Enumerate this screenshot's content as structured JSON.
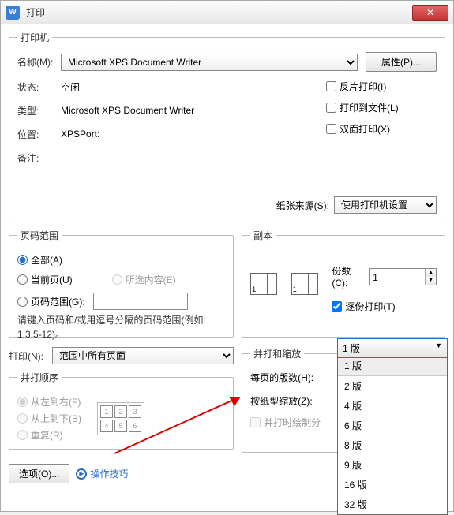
{
  "window": {
    "title": "打印"
  },
  "printer": {
    "legend": "打印机",
    "name_label": "名称(M):",
    "name_value": "Microsoft XPS Document Writer",
    "properties_btn": "属性(P)...",
    "status_label": "状态:",
    "status_value": "空闲",
    "type_label": "类型:",
    "type_value": "Microsoft XPS Document Writer",
    "location_label": "位置:",
    "location_value": "XPSPort:",
    "comment_label": "备注:",
    "reverse_print": "反片打印(I)",
    "print_to_file": "打印到文件(L)",
    "duplex": "双面打印(X)",
    "paper_source_label": "纸张来源(S):",
    "paper_source_value": "使用打印机设置"
  },
  "page_range": {
    "legend": "页码范围",
    "all": "全部(A)",
    "current": "当前页(U)",
    "selection": "所选内容(E)",
    "pages_label": "页码范围(G):",
    "hint": "请键入页码和/或用逗号分隔的页码范围(例如: 1,3,5-12)。"
  },
  "copies": {
    "legend": "副本",
    "copies_label": "份数(C):",
    "copies_value": "1",
    "collate": "逐份打印(T)"
  },
  "print_what": {
    "label": "打印(N):",
    "value": "范围中所有页面"
  },
  "order": {
    "legend": "并打顺序",
    "lr": "从左到右(F)",
    "tb": "从上到下(B)",
    "repeat": "重复(R)"
  },
  "zoom": {
    "legend": "并打和缩放",
    "per_page_label": "每页的版数(H):",
    "per_page_value": "1 版",
    "scale_label": "按纸型缩放(Z):",
    "custom_label": "并打时绘制分",
    "options": [
      "1 版",
      "2 版",
      "4 版",
      "6 版",
      "8 版",
      "9 版",
      "16 版",
      "32 版"
    ]
  },
  "footer": {
    "options_btn": "选项(O)...",
    "tips": "操作技巧"
  }
}
